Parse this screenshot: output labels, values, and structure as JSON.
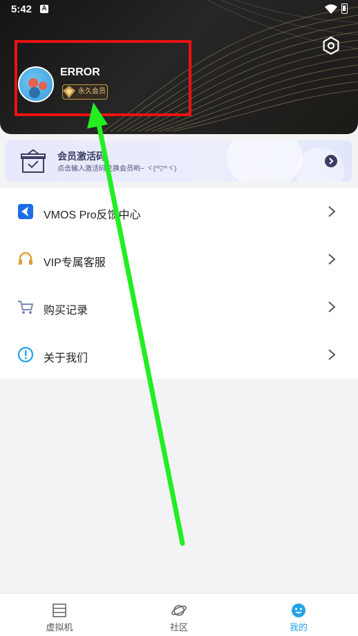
{
  "status_bar": {
    "time": "5:42",
    "app_icon": "A"
  },
  "profile": {
    "username": "ERROR",
    "vip_badge": "永久会员",
    "avatar_icon": "avatar-icon"
  },
  "promo": {
    "title": "会员激活码",
    "subtitle": "点击输入激活码兑换会员哟~ ヾ(^▽^ヾ)"
  },
  "menu": [
    {
      "label": "VMOS Pro反馈中心",
      "icon": "feedback-icon"
    },
    {
      "label": "VIP专属客服",
      "icon": "headset-icon"
    },
    {
      "label": "购买记录",
      "icon": "cart-icon"
    },
    {
      "label": "关于我们",
      "icon": "info-icon"
    }
  ],
  "tabs": [
    {
      "label": "虚拟机",
      "icon": "vm-icon"
    },
    {
      "label": "社区",
      "icon": "planet-icon"
    },
    {
      "label": "我的",
      "icon": "smile-icon",
      "active": true
    }
  ],
  "colors": {
    "accent": "#25a2ea",
    "annotation_box": "#ee1111",
    "annotation_arrow": "#22ee22"
  }
}
